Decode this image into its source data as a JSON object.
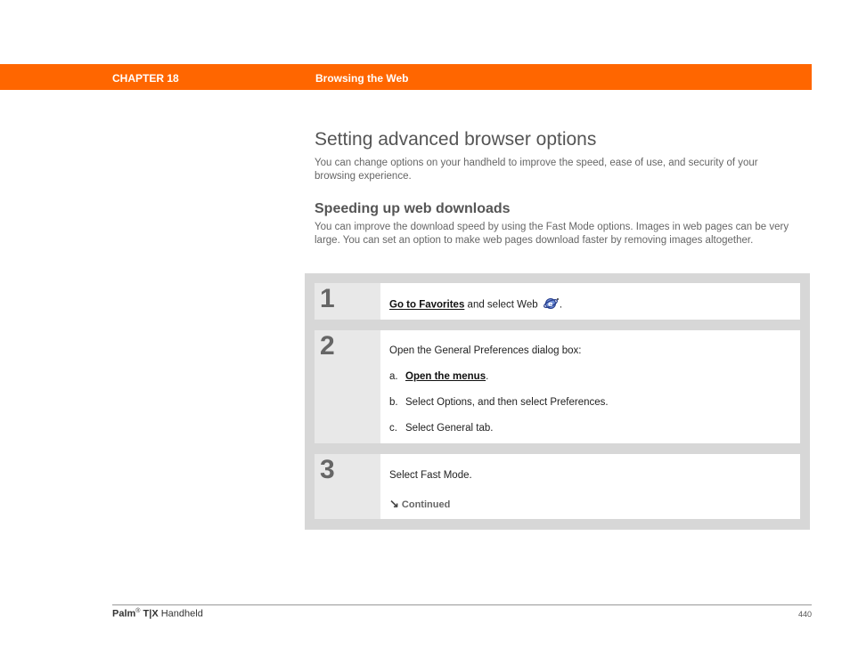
{
  "header": {
    "chapter": "CHAPTER 18",
    "chapter_title": "Browsing the Web"
  },
  "page_title": "Setting advanced browser options",
  "intro": "You can change options on your handheld to improve the speed, ease of use, and security of your browsing experience.",
  "section": {
    "heading": "Speeding up web downloads",
    "text": "You can improve the download speed by using the Fast Mode options. Images in web pages can be very large. You can set an option to make web pages download faster by removing images altogether."
  },
  "steps": {
    "s1": {
      "number": "1",
      "link": "Go to Favorites",
      "text": " and select Web",
      "end": ".",
      "icon": "web-browser-icon"
    },
    "s2": {
      "number": "2",
      "intro": "Open the General Preferences dialog box:",
      "a_prefix": "a.",
      "a_link": "Open the menus",
      "a_end": ".",
      "b_prefix": "b.",
      "b_text": "Select Options, and then select Preferences.",
      "c_prefix": "c.",
      "c_text": "Select General tab."
    },
    "s3": {
      "number": "3",
      "text": "Select Fast Mode.",
      "continued": "Continued",
      "continued_icon": "arrow-down-right-icon"
    }
  },
  "footer": {
    "brand": "Palm",
    "registered": "®",
    "model": "T|X",
    "product": "Handheld",
    "page_number": "440"
  },
  "colors": {
    "header_bar": "#ff6600",
    "panel": "#d7d7d7",
    "number_column": "#e8e8e8"
  }
}
